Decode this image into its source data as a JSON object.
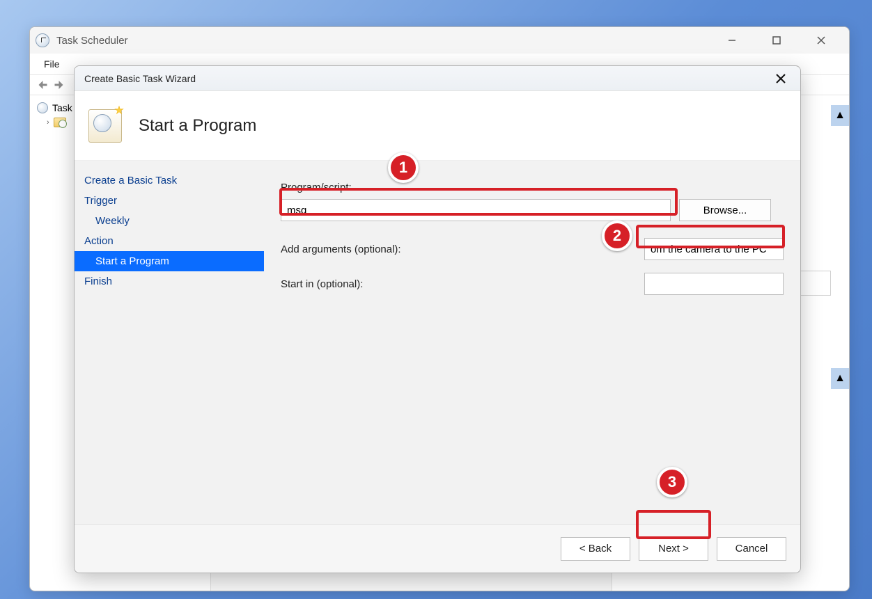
{
  "main_window": {
    "title": "Task Scheduler",
    "menu": {
      "file": "File"
    },
    "tree": {
      "root_label": "Task",
      "root_truncated": "Task"
    }
  },
  "wizard": {
    "title": "Create Basic Task Wizard",
    "header_title": "Start a Program",
    "nav": {
      "create": "Create a Basic Task",
      "trigger": "Trigger",
      "trigger_sub": "Weekly",
      "action": "Action",
      "action_sub": "Start a Program",
      "finish": "Finish"
    },
    "form": {
      "program_label": "Program/script:",
      "program_value": "msg",
      "browse_label": "Browse...",
      "args_label": "Add arguments (optional):",
      "args_value": "om the camera to the PC\"",
      "startin_label": "Start in (optional):",
      "startin_value": ""
    },
    "buttons": {
      "back": "< Back",
      "next": "Next >",
      "cancel": "Cancel"
    }
  },
  "annotations": {
    "c1": "1",
    "c2": "2",
    "c3": "3"
  }
}
